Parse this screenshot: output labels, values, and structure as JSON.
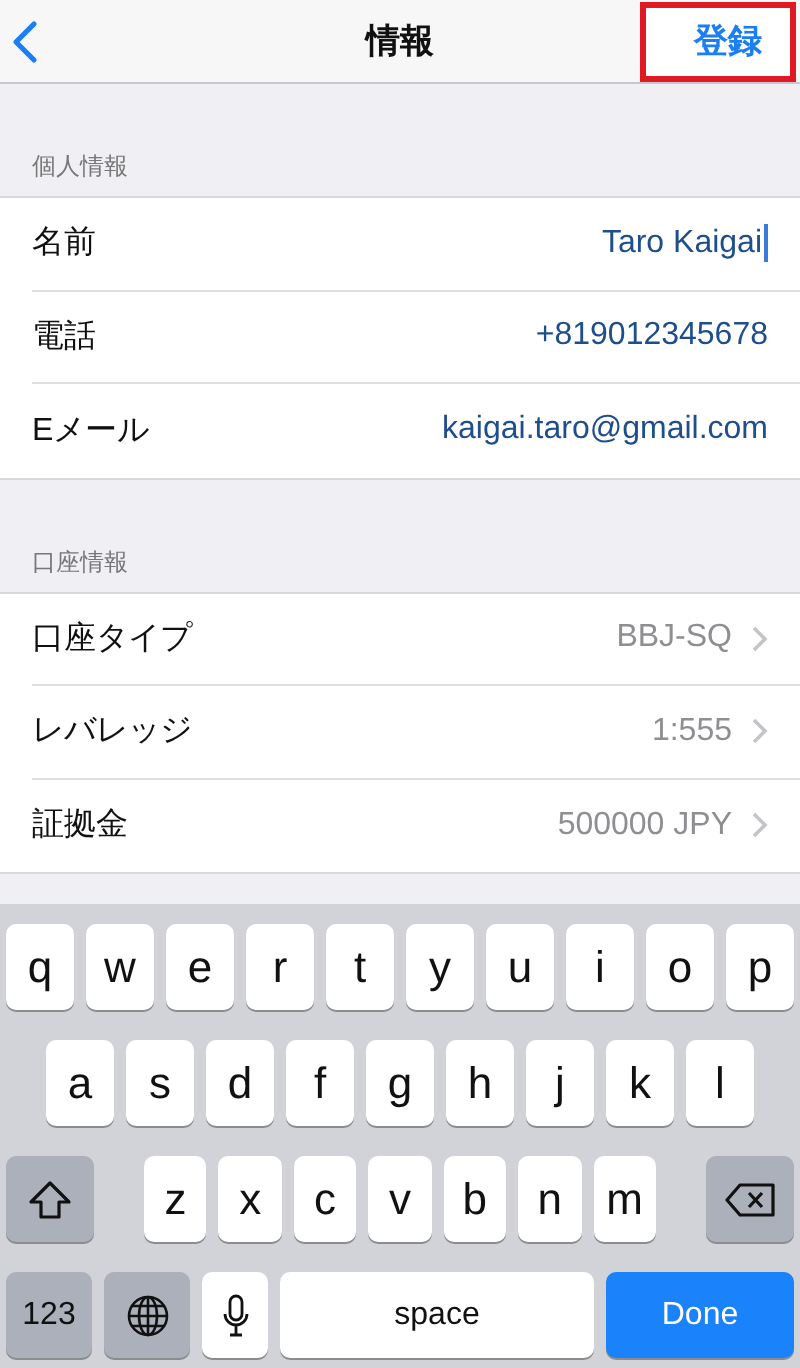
{
  "nav": {
    "title": "情報",
    "action": {
      "label": "登録",
      "highlighted": true
    }
  },
  "sections": [
    {
      "header": "個人情報",
      "rows": [
        {
          "kind": "input",
          "label": "名前",
          "value": "Taro Kaigai",
          "focused": true
        },
        {
          "kind": "input",
          "label": "電話",
          "value": "+819012345678",
          "focused": false
        },
        {
          "kind": "input",
          "label": "Eメール",
          "value": "kaigai.taro@gmail.com",
          "focused": false
        }
      ]
    },
    {
      "header": "口座情報",
      "rows": [
        {
          "kind": "picker",
          "label": "口座タイプ",
          "value": "BBJ-SQ"
        },
        {
          "kind": "picker",
          "label": "レバレッジ",
          "value": "1:555"
        },
        {
          "kind": "picker",
          "label": "証拠金",
          "value": "500000 JPY"
        }
      ]
    }
  ],
  "keyboard": {
    "rows": [
      [
        "q",
        "w",
        "e",
        "r",
        "t",
        "y",
        "u",
        "i",
        "o",
        "p"
      ],
      [
        "a",
        "s",
        "d",
        "f",
        "g",
        "h",
        "j",
        "k",
        "l"
      ],
      [
        "z",
        "x",
        "c",
        "v",
        "b",
        "n",
        "m"
      ]
    ],
    "numbers_key": "123",
    "space_key": "space",
    "return_key": "Done"
  }
}
